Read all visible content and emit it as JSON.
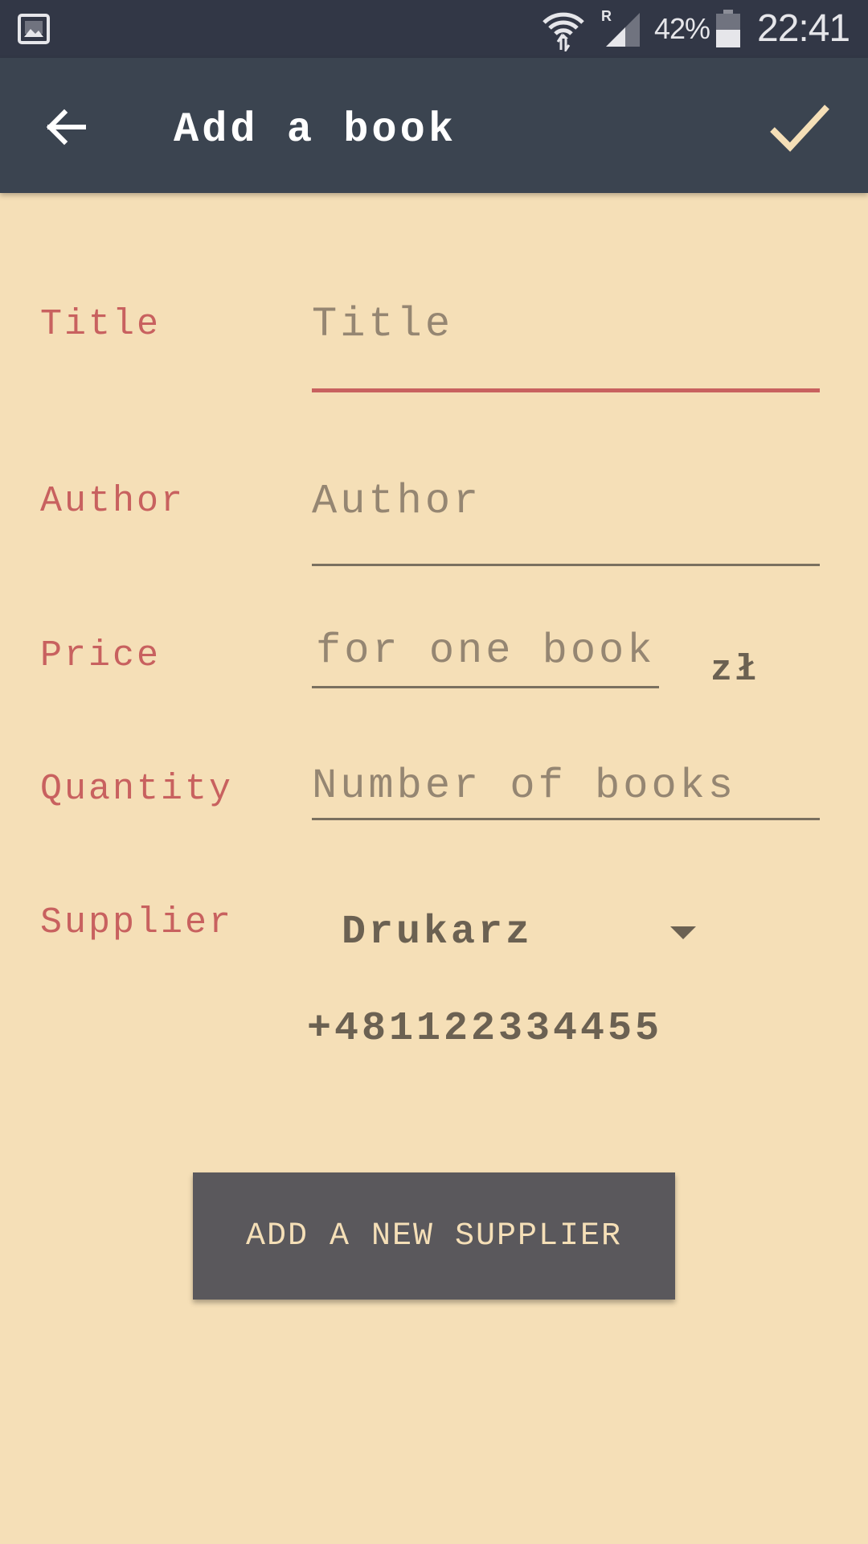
{
  "status_bar": {
    "battery_percent": "42%",
    "time": "22:41",
    "icons": [
      "gallery-icon",
      "wifi-icon",
      "signal-icon",
      "battery-icon"
    ]
  },
  "app_bar": {
    "title": "Add a book",
    "back_icon": "arrow-left-icon",
    "save_icon": "check-icon"
  },
  "form": {
    "title": {
      "label": "Title",
      "placeholder": "Title"
    },
    "author": {
      "label": "Author",
      "placeholder": "Author"
    },
    "price": {
      "label": "Price",
      "placeholder": "for one book",
      "unit": "zł"
    },
    "quantity": {
      "label": "Quantity",
      "placeholder": "Number of books"
    },
    "supplier": {
      "label": "Supplier",
      "selected": "Drukarz",
      "phone": "+481122334455"
    }
  },
  "add_supplier_button": {
    "label": "ADD A NEW SUPPLIER"
  },
  "colors": {
    "background": "#F5DFB7",
    "status_bar": "#323746",
    "app_bar": "#3B4450",
    "label": "#C8615F",
    "placeholder": "#958672",
    "value_text": "#6B6152",
    "button": "#5A585C",
    "check_icon": "#F5DFB7"
  }
}
